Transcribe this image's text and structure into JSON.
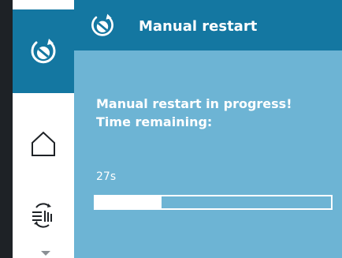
{
  "sidebar": {
    "items": [
      {
        "name": "manual-restart",
        "icon": "restart-icon",
        "active": true
      },
      {
        "name": "home",
        "icon": "home-icon",
        "active": false
      },
      {
        "name": "settings",
        "icon": "settings-icon",
        "active": false
      }
    ]
  },
  "header": {
    "title": "Manual restart",
    "icon": "restart-icon"
  },
  "main": {
    "message": "Manual restart in progress!\nTime remaining:",
    "time_remaining": "27s",
    "progress_fraction": 0.28
  },
  "colors": {
    "accent": "#1477a1",
    "content_bg": "#6db4d4",
    "text": "#ffffff"
  }
}
